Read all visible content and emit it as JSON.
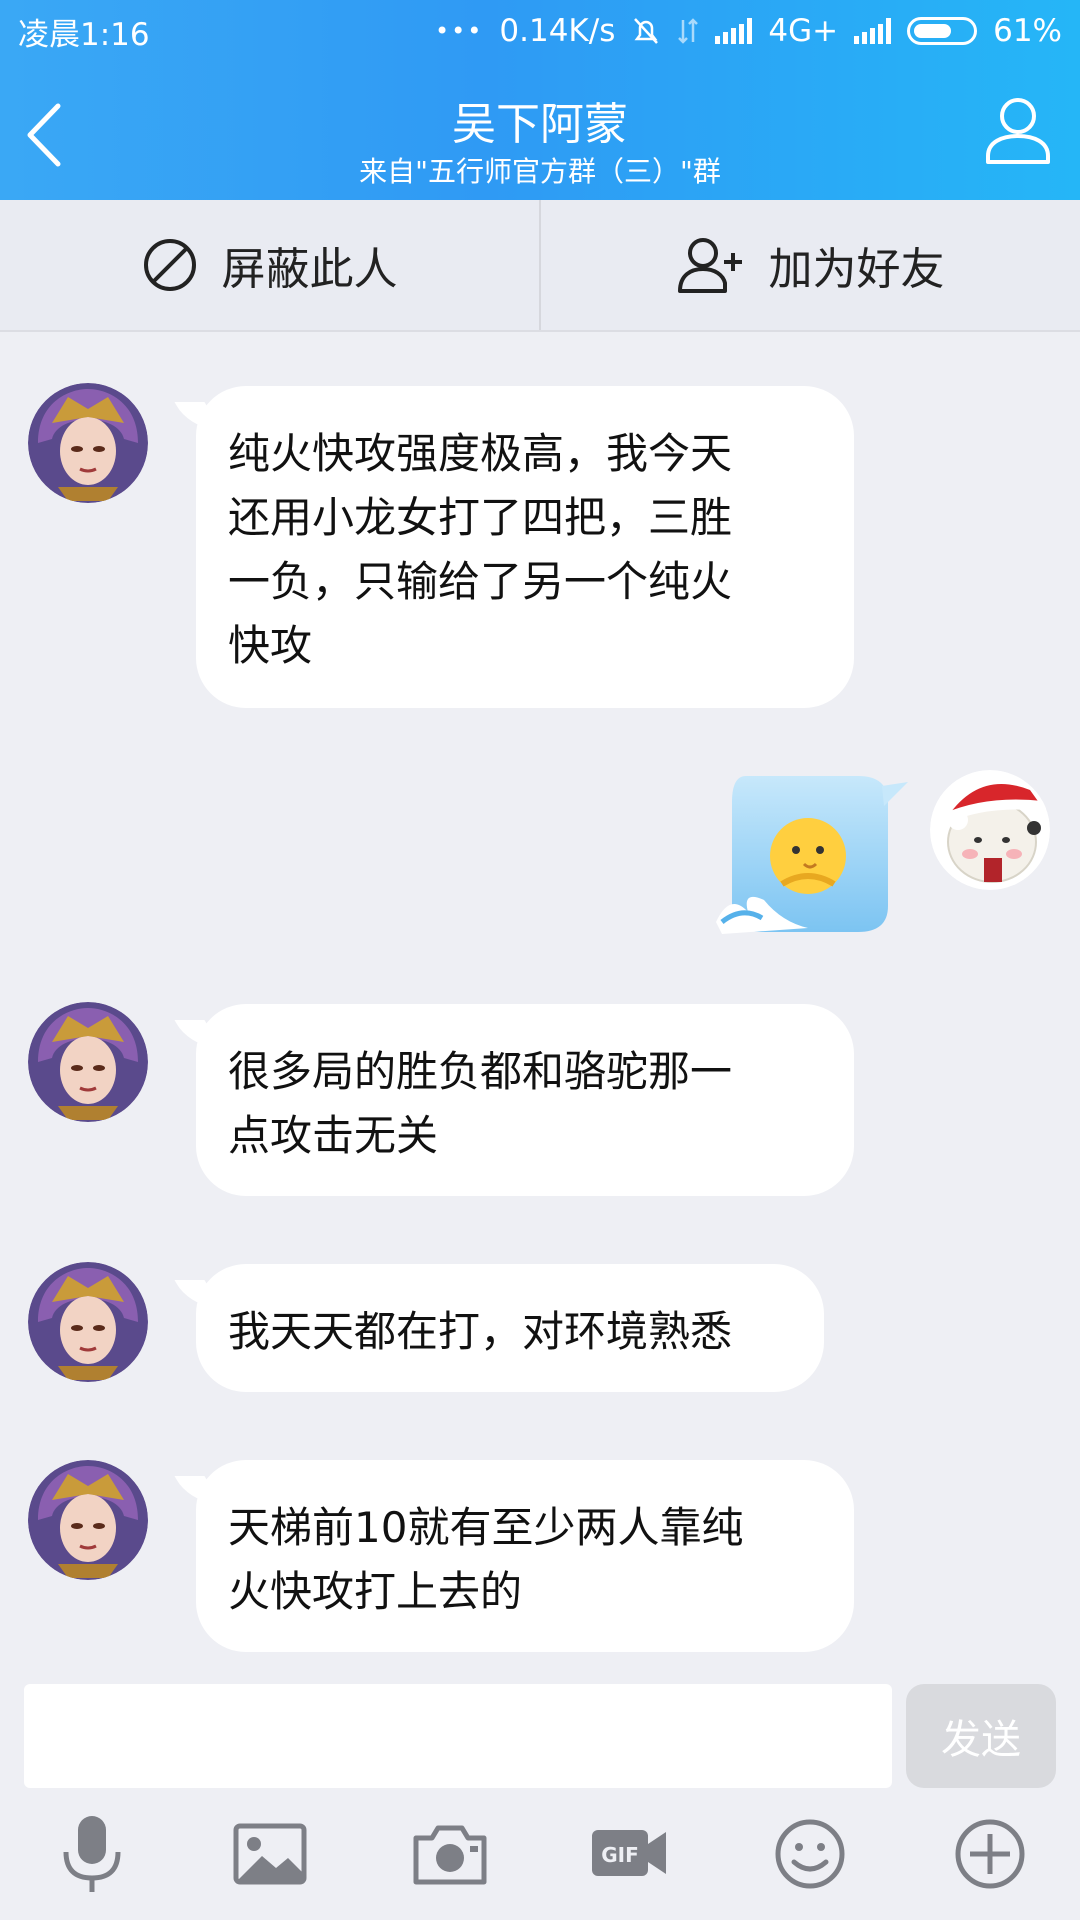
{
  "status": {
    "time": "凌晨1:16",
    "dots": "•••",
    "speed": "0.14K/s",
    "network": "4G+",
    "battery": "61%"
  },
  "header": {
    "title": "吴下阿蒙",
    "subtitle": "来自\"五行师官方群（三）\"群",
    "back_icon": "chevron-left-icon",
    "profile_icon": "person-icon"
  },
  "actions": {
    "block_label": "屏蔽此人",
    "block_icon": "block-icon",
    "add_friend_label": "加为好友",
    "add_friend_icon": "add-person-icon"
  },
  "messages": [
    {
      "side": "left",
      "text": "纯火快攻强度极高，我今天\n还用小龙女打了四把，三胜\n一负，只输给了另一个纯火\n快攻"
    },
    {
      "side": "right",
      "type": "emoji",
      "emoji": "waving-chick-emoji"
    },
    {
      "side": "left",
      "text": "很多局的胜负都和骆驼那一\n点攻击无关"
    },
    {
      "side": "left",
      "text": "我天天都在打，对环境熟悉"
    },
    {
      "side": "left",
      "text": "天梯前10就有至少两人靠纯\n火快攻打上去的"
    }
  ],
  "input": {
    "placeholder": "",
    "send_label": "发送"
  },
  "toolbar": {
    "icons": [
      "microphone-icon",
      "image-icon",
      "camera-icon",
      "gif-icon",
      "emoji-icon",
      "plus-icon"
    ]
  },
  "colors": {
    "header_start": "#3aa8f5",
    "header_end": "#25b6f7",
    "background": "#eeeff4",
    "bubble": "#ffffff",
    "icon_gray": "#7d7f86"
  }
}
